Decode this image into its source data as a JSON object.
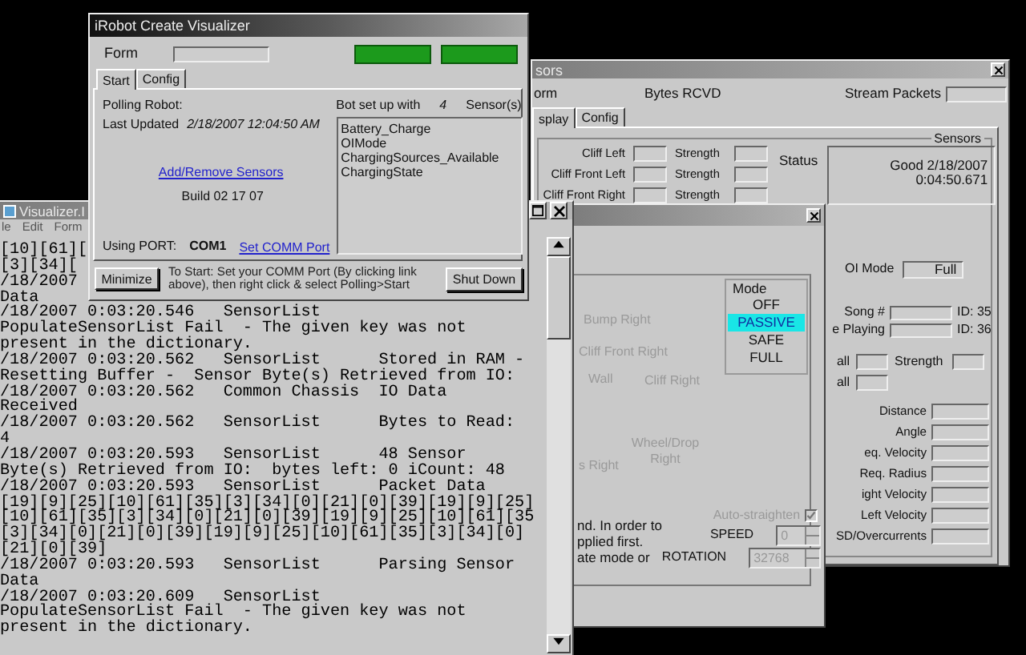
{
  "irobot_window": {
    "title": "iRobot Create Visualizer",
    "form_label": "Form",
    "tabs": [
      {
        "label": "Start",
        "selected": true
      },
      {
        "label": "Config",
        "selected": false
      }
    ],
    "polling_label": "Polling Robot:",
    "last_updated_label": "Last Updated",
    "last_updated_value": "2/18/2007 12:04:50 AM",
    "sensor_count_prefix": "Bot set up with",
    "sensor_count": "4",
    "sensor_count_suffix": "Sensor(s)",
    "sensors": [
      "Battery_Charge",
      "OIMode",
      "ChargingSources_Available",
      "ChargingState"
    ],
    "add_remove_link": "Add/Remove Sensors",
    "build": "Build 02 17 07",
    "port_label": "Using PORT:",
    "port_value": "COM1",
    "port_link": "Set COMM Port",
    "minimize_button": "Minimize",
    "instructions": [
      "To Start: Set your COMM Port (By clicking link",
      "above), then right click & select Polling>Start"
    ],
    "shutdown_button": "Shut Down"
  },
  "sensors_window": {
    "title": "sors",
    "form_label": "orm",
    "bytes_label": "Bytes RCVD",
    "stream_label": "Stream Packets",
    "tabs": [
      {
        "label": "splay",
        "selected": true
      },
      {
        "label": "Config",
        "selected": false
      }
    ],
    "group_label": "Sensors",
    "cliff_rows": [
      {
        "label": "Cliff Left",
        "strength_label": "Strength"
      },
      {
        "label": "Cliff Front Left",
        "strength_label": "Strength"
      },
      {
        "label": "Cliff Front Right",
        "strength_label": "Strength"
      }
    ],
    "status_label": "Status",
    "status_lines": [
      "Good 2/18/2007",
      "0:04:50.671"
    ],
    "oi_mode_label": "OI Mode",
    "oi_mode_value": "Full",
    "song_rows": [
      {
        "label": "Song #",
        "id": "ID: 35"
      },
      {
        "label": "e Playing",
        "id": "ID: 36"
      }
    ],
    "wall_rows": [
      {
        "label": "all",
        "strength_label": "Strength"
      },
      {
        "label": "all"
      }
    ],
    "motion_rows": [
      "Distance",
      "Angle",
      "eq. Velocity",
      "Req. Radius",
      "ight Velocity",
      "Left Velocity",
      "SD/Overcurrents"
    ]
  },
  "mode_window": {
    "mode_label": "Mode",
    "modes": [
      {
        "label": "OFF",
        "selected": false
      },
      {
        "label": "PASSIVE",
        "selected": true
      },
      {
        "label": "SAFE",
        "selected": false
      },
      {
        "label": "FULL",
        "selected": false
      }
    ],
    "sensor_labels": [
      "Bump Right",
      "Cliff Front Right",
      "Wall",
      "Cliff Right",
      "Wheel/Drop Right",
      "s Right"
    ],
    "note_lines": [
      "nd. In order to",
      "pplied first.",
      "ate mode or"
    ],
    "auto_straighten": {
      "label": "Auto-straighten",
      "checked": true,
      "disabled": true
    },
    "speed": {
      "label": "SPEED",
      "value": "0"
    },
    "rotation": {
      "label": "ROTATION",
      "value": "32768"
    }
  },
  "console_window": {
    "title": "Visualizer.I",
    "menu": [
      "le",
      "Edit",
      "Form"
    ],
    "log_lines": [
      "[10][61][",
      "[3][34][",
      "/18/2007",
      "Data",
      "/18/2007 0:03:20.546   SensorList",
      "PopulateSensorList Fail  - The given key was not",
      "present in the dictionary.",
      "/18/2007 0:03:20.562   SensorList      Stored in RAM -",
      "Resetting Buffer -  Sensor Byte(s) Retrieved from IO:",
      "/18/2007 0:03:20.562   Common Chassis  IO Data",
      "Received",
      "/18/2007 0:03:20.562   SensorList      Bytes to Read:",
      "4",
      "/18/2007 0:03:20.593   SensorList      48 Sensor",
      "Byte(s) Retrieved from IO:  bytes left: 0 iCount: 48",
      "/18/2007 0:03:20.593   SensorList      Packet Data",
      "[19][9][25][10][61][35][3][34][0][21][0][39][19][9][25]",
      "[10][61][35][3][34][0][21][0][39][19][9][25][10][61][35",
      "[3][34][0][21][0][39][19][9][25][10][61][35][3][34][0]",
      "[21][0][39]",
      "/18/2007 0:03:20.593   SensorList      Parsing Sensor",
      "Data",
      "/18/2007 0:03:20.609   SensorList",
      "PopulateSensorList Fail  - The given key was not",
      "present in the dictionary."
    ]
  }
}
